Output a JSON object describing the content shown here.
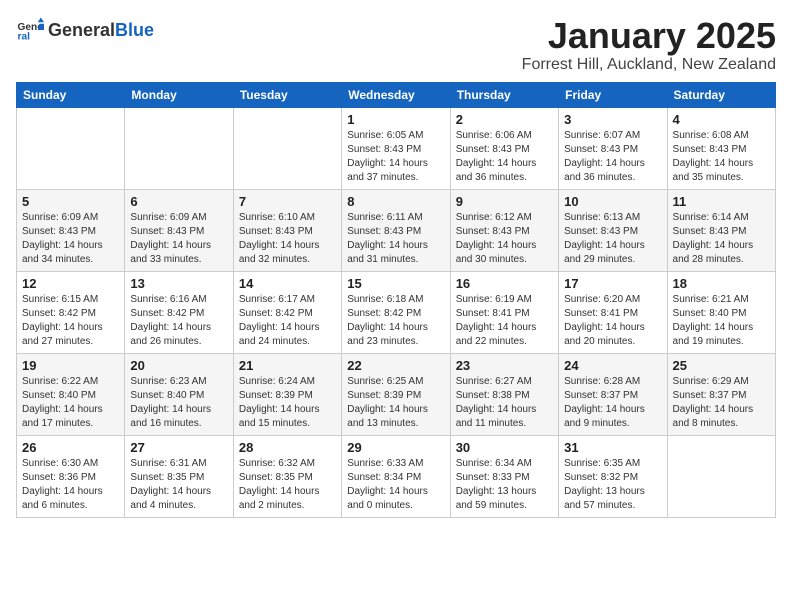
{
  "header": {
    "logo_general": "General",
    "logo_blue": "Blue",
    "month": "January 2025",
    "location": "Forrest Hill, Auckland, New Zealand"
  },
  "weekdays": [
    "Sunday",
    "Monday",
    "Tuesday",
    "Wednesday",
    "Thursday",
    "Friday",
    "Saturday"
  ],
  "weeks": [
    [
      {
        "day": "",
        "info": ""
      },
      {
        "day": "",
        "info": ""
      },
      {
        "day": "",
        "info": ""
      },
      {
        "day": "1",
        "info": "Sunrise: 6:05 AM\nSunset: 8:43 PM\nDaylight: 14 hours\nand 37 minutes."
      },
      {
        "day": "2",
        "info": "Sunrise: 6:06 AM\nSunset: 8:43 PM\nDaylight: 14 hours\nand 36 minutes."
      },
      {
        "day": "3",
        "info": "Sunrise: 6:07 AM\nSunset: 8:43 PM\nDaylight: 14 hours\nand 36 minutes."
      },
      {
        "day": "4",
        "info": "Sunrise: 6:08 AM\nSunset: 8:43 PM\nDaylight: 14 hours\nand 35 minutes."
      }
    ],
    [
      {
        "day": "5",
        "info": "Sunrise: 6:09 AM\nSunset: 8:43 PM\nDaylight: 14 hours\nand 34 minutes."
      },
      {
        "day": "6",
        "info": "Sunrise: 6:09 AM\nSunset: 8:43 PM\nDaylight: 14 hours\nand 33 minutes."
      },
      {
        "day": "7",
        "info": "Sunrise: 6:10 AM\nSunset: 8:43 PM\nDaylight: 14 hours\nand 32 minutes."
      },
      {
        "day": "8",
        "info": "Sunrise: 6:11 AM\nSunset: 8:43 PM\nDaylight: 14 hours\nand 31 minutes."
      },
      {
        "day": "9",
        "info": "Sunrise: 6:12 AM\nSunset: 8:43 PM\nDaylight: 14 hours\nand 30 minutes."
      },
      {
        "day": "10",
        "info": "Sunrise: 6:13 AM\nSunset: 8:43 PM\nDaylight: 14 hours\nand 29 minutes."
      },
      {
        "day": "11",
        "info": "Sunrise: 6:14 AM\nSunset: 8:43 PM\nDaylight: 14 hours\nand 28 minutes."
      }
    ],
    [
      {
        "day": "12",
        "info": "Sunrise: 6:15 AM\nSunset: 8:42 PM\nDaylight: 14 hours\nand 27 minutes."
      },
      {
        "day": "13",
        "info": "Sunrise: 6:16 AM\nSunset: 8:42 PM\nDaylight: 14 hours\nand 26 minutes."
      },
      {
        "day": "14",
        "info": "Sunrise: 6:17 AM\nSunset: 8:42 PM\nDaylight: 14 hours\nand 24 minutes."
      },
      {
        "day": "15",
        "info": "Sunrise: 6:18 AM\nSunset: 8:42 PM\nDaylight: 14 hours\nand 23 minutes."
      },
      {
        "day": "16",
        "info": "Sunrise: 6:19 AM\nSunset: 8:41 PM\nDaylight: 14 hours\nand 22 minutes."
      },
      {
        "day": "17",
        "info": "Sunrise: 6:20 AM\nSunset: 8:41 PM\nDaylight: 14 hours\nand 20 minutes."
      },
      {
        "day": "18",
        "info": "Sunrise: 6:21 AM\nSunset: 8:40 PM\nDaylight: 14 hours\nand 19 minutes."
      }
    ],
    [
      {
        "day": "19",
        "info": "Sunrise: 6:22 AM\nSunset: 8:40 PM\nDaylight: 14 hours\nand 17 minutes."
      },
      {
        "day": "20",
        "info": "Sunrise: 6:23 AM\nSunset: 8:40 PM\nDaylight: 14 hours\nand 16 minutes."
      },
      {
        "day": "21",
        "info": "Sunrise: 6:24 AM\nSunset: 8:39 PM\nDaylight: 14 hours\nand 15 minutes."
      },
      {
        "day": "22",
        "info": "Sunrise: 6:25 AM\nSunset: 8:39 PM\nDaylight: 14 hours\nand 13 minutes."
      },
      {
        "day": "23",
        "info": "Sunrise: 6:27 AM\nSunset: 8:38 PM\nDaylight: 14 hours\nand 11 minutes."
      },
      {
        "day": "24",
        "info": "Sunrise: 6:28 AM\nSunset: 8:37 PM\nDaylight: 14 hours\nand 9 minutes."
      },
      {
        "day": "25",
        "info": "Sunrise: 6:29 AM\nSunset: 8:37 PM\nDaylight: 14 hours\nand 8 minutes."
      }
    ],
    [
      {
        "day": "26",
        "info": "Sunrise: 6:30 AM\nSunset: 8:36 PM\nDaylight: 14 hours\nand 6 minutes."
      },
      {
        "day": "27",
        "info": "Sunrise: 6:31 AM\nSunset: 8:35 PM\nDaylight: 14 hours\nand 4 minutes."
      },
      {
        "day": "28",
        "info": "Sunrise: 6:32 AM\nSunset: 8:35 PM\nDaylight: 14 hours\nand 2 minutes."
      },
      {
        "day": "29",
        "info": "Sunrise: 6:33 AM\nSunset: 8:34 PM\nDaylight: 14 hours\nand 0 minutes."
      },
      {
        "day": "30",
        "info": "Sunrise: 6:34 AM\nSunset: 8:33 PM\nDaylight: 13 hours\nand 59 minutes."
      },
      {
        "day": "31",
        "info": "Sunrise: 6:35 AM\nSunset: 8:32 PM\nDaylight: 13 hours\nand 57 minutes."
      },
      {
        "day": "",
        "info": ""
      }
    ]
  ]
}
